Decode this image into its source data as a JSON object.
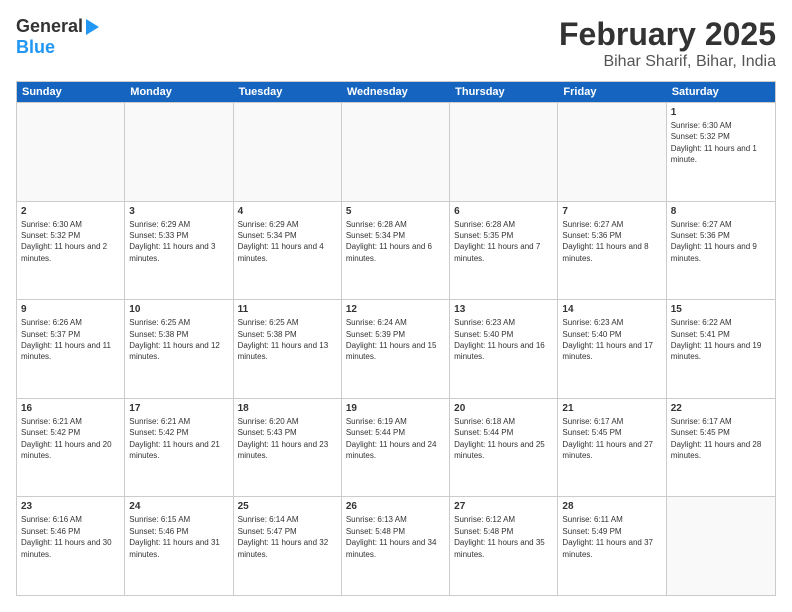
{
  "header": {
    "logo_line1": "General",
    "logo_line2": "Blue",
    "title": "February 2025",
    "subtitle": "Bihar Sharif, Bihar, India"
  },
  "days": [
    "Sunday",
    "Monday",
    "Tuesday",
    "Wednesday",
    "Thursday",
    "Friday",
    "Saturday"
  ],
  "weeks": [
    [
      {
        "day": "",
        "empty": true
      },
      {
        "day": "",
        "empty": true
      },
      {
        "day": "",
        "empty": true
      },
      {
        "day": "",
        "empty": true
      },
      {
        "day": "",
        "empty": true
      },
      {
        "day": "",
        "empty": true
      },
      {
        "day": "1",
        "sunrise": "6:30 AM",
        "sunset": "5:32 PM",
        "daylight": "11 hours and 1 minute."
      }
    ],
    [
      {
        "day": "2",
        "sunrise": "6:30 AM",
        "sunset": "5:32 PM",
        "daylight": "11 hours and 2 minutes."
      },
      {
        "day": "3",
        "sunrise": "6:29 AM",
        "sunset": "5:33 PM",
        "daylight": "11 hours and 3 minutes."
      },
      {
        "day": "4",
        "sunrise": "6:29 AM",
        "sunset": "5:34 PM",
        "daylight": "11 hours and 4 minutes."
      },
      {
        "day": "5",
        "sunrise": "6:28 AM",
        "sunset": "5:34 PM",
        "daylight": "11 hours and 6 minutes."
      },
      {
        "day": "6",
        "sunrise": "6:28 AM",
        "sunset": "5:35 PM",
        "daylight": "11 hours and 7 minutes."
      },
      {
        "day": "7",
        "sunrise": "6:27 AM",
        "sunset": "5:36 PM",
        "daylight": "11 hours and 8 minutes."
      },
      {
        "day": "8",
        "sunrise": "6:27 AM",
        "sunset": "5:36 PM",
        "daylight": "11 hours and 9 minutes."
      }
    ],
    [
      {
        "day": "9",
        "sunrise": "6:26 AM",
        "sunset": "5:37 PM",
        "daylight": "11 hours and 11 minutes."
      },
      {
        "day": "10",
        "sunrise": "6:25 AM",
        "sunset": "5:38 PM",
        "daylight": "11 hours and 12 minutes."
      },
      {
        "day": "11",
        "sunrise": "6:25 AM",
        "sunset": "5:38 PM",
        "daylight": "11 hours and 13 minutes."
      },
      {
        "day": "12",
        "sunrise": "6:24 AM",
        "sunset": "5:39 PM",
        "daylight": "11 hours and 15 minutes."
      },
      {
        "day": "13",
        "sunrise": "6:23 AM",
        "sunset": "5:40 PM",
        "daylight": "11 hours and 16 minutes."
      },
      {
        "day": "14",
        "sunrise": "6:23 AM",
        "sunset": "5:40 PM",
        "daylight": "11 hours and 17 minutes."
      },
      {
        "day": "15",
        "sunrise": "6:22 AM",
        "sunset": "5:41 PM",
        "daylight": "11 hours and 19 minutes."
      }
    ],
    [
      {
        "day": "16",
        "sunrise": "6:21 AM",
        "sunset": "5:42 PM",
        "daylight": "11 hours and 20 minutes."
      },
      {
        "day": "17",
        "sunrise": "6:21 AM",
        "sunset": "5:42 PM",
        "daylight": "11 hours and 21 minutes."
      },
      {
        "day": "18",
        "sunrise": "6:20 AM",
        "sunset": "5:43 PM",
        "daylight": "11 hours and 23 minutes."
      },
      {
        "day": "19",
        "sunrise": "6:19 AM",
        "sunset": "5:44 PM",
        "daylight": "11 hours and 24 minutes."
      },
      {
        "day": "20",
        "sunrise": "6:18 AM",
        "sunset": "5:44 PM",
        "daylight": "11 hours and 25 minutes."
      },
      {
        "day": "21",
        "sunrise": "6:17 AM",
        "sunset": "5:45 PM",
        "daylight": "11 hours and 27 minutes."
      },
      {
        "day": "22",
        "sunrise": "6:17 AM",
        "sunset": "5:45 PM",
        "daylight": "11 hours and 28 minutes."
      }
    ],
    [
      {
        "day": "23",
        "sunrise": "6:16 AM",
        "sunset": "5:46 PM",
        "daylight": "11 hours and 30 minutes."
      },
      {
        "day": "24",
        "sunrise": "6:15 AM",
        "sunset": "5:46 PM",
        "daylight": "11 hours and 31 minutes."
      },
      {
        "day": "25",
        "sunrise": "6:14 AM",
        "sunset": "5:47 PM",
        "daylight": "11 hours and 32 minutes."
      },
      {
        "day": "26",
        "sunrise": "6:13 AM",
        "sunset": "5:48 PM",
        "daylight": "11 hours and 34 minutes."
      },
      {
        "day": "27",
        "sunrise": "6:12 AM",
        "sunset": "5:48 PM",
        "daylight": "11 hours and 35 minutes."
      },
      {
        "day": "28",
        "sunrise": "6:11 AM",
        "sunset": "5:49 PM",
        "daylight": "11 hours and 37 minutes."
      },
      {
        "day": "",
        "empty": true
      }
    ]
  ]
}
